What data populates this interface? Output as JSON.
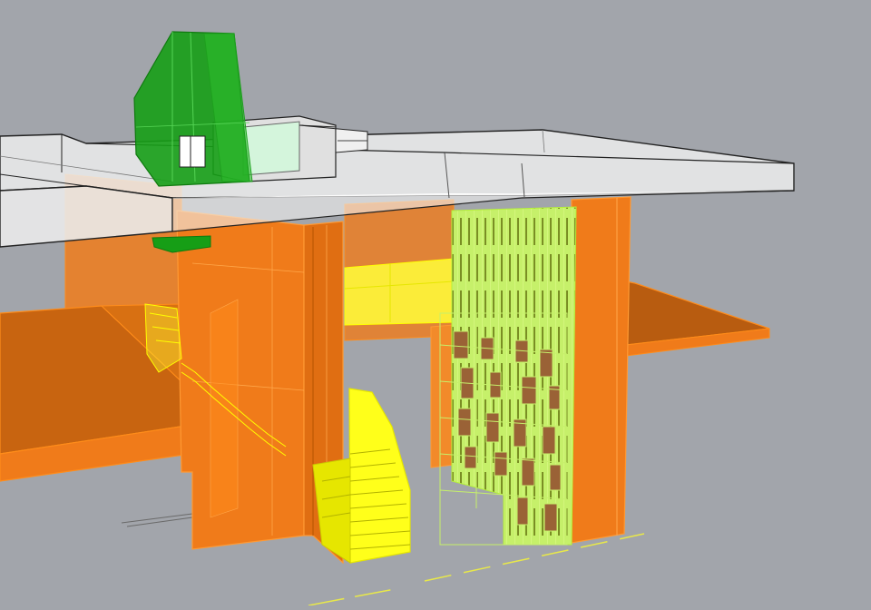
{
  "viewport": {
    "background": "#a2a5ab",
    "render_mode": "ghosted",
    "projection": "perspective"
  },
  "layers": [
    {
      "name": "slabs",
      "color": "#ff7f0e"
    },
    {
      "name": "roof-and-upper-floor",
      "color": "#e6e6e6"
    },
    {
      "name": "rooftop-pavilion",
      "color": "#1aa31a"
    },
    {
      "name": "staircases",
      "color": "#ffff00"
    },
    {
      "name": "brise-soleil",
      "color": "#b6f03a"
    },
    {
      "name": "brick-screen",
      "color": "#9a6236"
    },
    {
      "name": "ground-lines",
      "color": "#e8e84a"
    }
  ]
}
